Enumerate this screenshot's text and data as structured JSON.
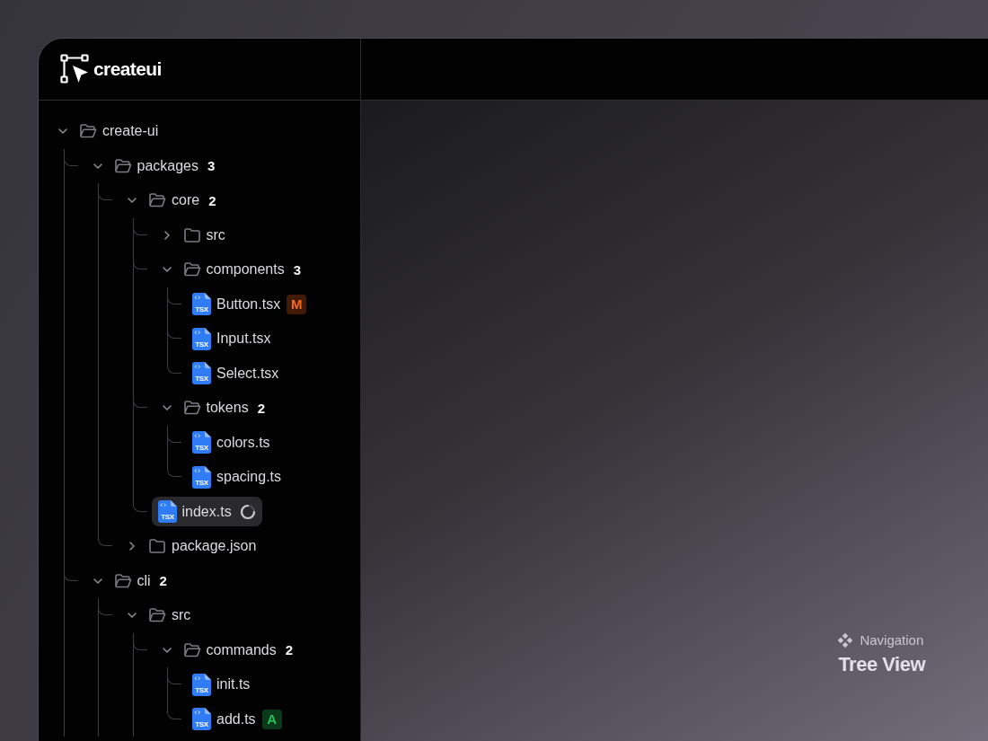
{
  "header": {
    "logo_text": "createui"
  },
  "tree": [
    {
      "name": "create-ui",
      "kind": "folder",
      "expanded": true,
      "selected": false,
      "children": [
        {
          "name": "packages",
          "kind": "folder",
          "expanded": true,
          "count": "3",
          "selected": false,
          "children": [
            {
              "name": "core",
              "kind": "folder",
              "expanded": true,
              "count": "2",
              "selected": false,
              "children": [
                {
                  "name": "src",
                  "kind": "folder",
                  "expanded": false,
                  "selected": false
                },
                {
                  "name": "components",
                  "kind": "folder",
                  "expanded": true,
                  "count": "3",
                  "selected": false,
                  "children": [
                    {
                      "name": "Button.tsx",
                      "kind": "file",
                      "icon_label": "TSX",
                      "selected": false,
                      "loading": false,
                      "badge": {
                        "text": "M",
                        "kind": "modified"
                      }
                    },
                    {
                      "name": "Input.tsx",
                      "kind": "file",
                      "icon_label": "TSX",
                      "selected": false,
                      "loading": false
                    },
                    {
                      "name": "Select.tsx",
                      "kind": "file",
                      "icon_label": "TSX",
                      "selected": false,
                      "loading": false
                    }
                  ]
                },
                {
                  "name": "tokens",
                  "kind": "folder",
                  "expanded": true,
                  "count": "2",
                  "selected": false,
                  "children": [
                    {
                      "name": "colors.ts",
                      "kind": "file",
                      "icon_label": "TSX",
                      "selected": false,
                      "loading": false
                    },
                    {
                      "name": "spacing.ts",
                      "kind": "file",
                      "icon_label": "TSX",
                      "selected": false,
                      "loading": false
                    }
                  ]
                },
                {
                  "name": "index.ts",
                  "kind": "file",
                  "icon_label": "TSX",
                  "selected": true,
                  "loading": true
                }
              ]
            },
            {
              "name": "package.json",
              "kind": "folder",
              "expanded": false,
              "selected": false
            }
          ]
        },
        {
          "name": "cli",
          "kind": "folder",
          "expanded": true,
          "count": "2",
          "selected": false,
          "more_below": true,
          "children": [
            {
              "name": "src",
              "kind": "folder",
              "expanded": true,
              "selected": false,
              "more_below": true,
              "children": [
                {
                  "name": "commands",
                  "kind": "folder",
                  "expanded": true,
                  "count": "2",
                  "selected": false,
                  "more_below": true,
                  "children": [
                    {
                      "name": "init.ts",
                      "kind": "file",
                      "icon_label": "TSX",
                      "selected": false,
                      "loading": false
                    },
                    {
                      "name": "add.ts",
                      "kind": "file",
                      "icon_label": "TSX",
                      "selected": false,
                      "loading": false,
                      "badge": {
                        "text": "A",
                        "kind": "added"
                      }
                    }
                  ]
                }
              ]
            }
          ]
        }
      ]
    }
  ],
  "caption": {
    "eyebrow": "Navigation",
    "title": "Tree View"
  }
}
